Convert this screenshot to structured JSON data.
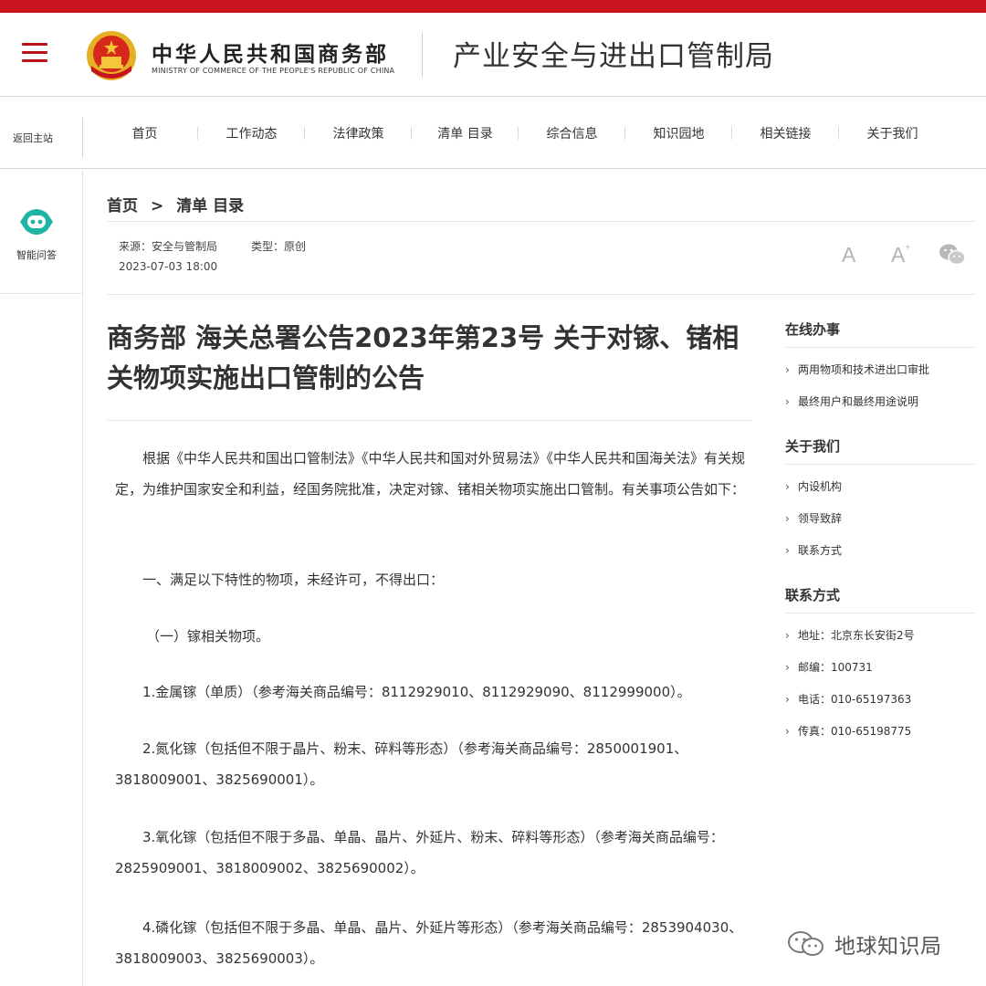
{
  "header": {
    "ministry_cn": "中华人民共和国商务部",
    "ministry_en": "MINISTRY OF COMMERCE OF THE PEOPLE'S REPUBLIC OF CHINA",
    "bureau": "产业安全与进出口管制局"
  },
  "nav": {
    "return_home": "返回主站",
    "items": [
      "首页",
      "工作动态",
      "法律政策",
      "清单 目录",
      "综合信息",
      "知识园地",
      "相关链接",
      "关于我们"
    ]
  },
  "side": {
    "ai_label": "智能问答"
  },
  "breadcrumb": {
    "home": "首页",
    "sep": ">",
    "current": "清单 目录"
  },
  "meta": {
    "source": "来源：安全与管制局",
    "type": "类型：原创",
    "date": "2023-07-03 18:00",
    "font_small": "A",
    "font_large": "A",
    "font_large_sup": "+"
  },
  "article": {
    "title": "商务部 海关总署公告2023年第23号 关于对镓、锗相关物项实施出口管制的公告",
    "paragraphs": [
      "根据《中华人民共和国出口管制法》《中华人民共和国对外贸易法》《中华人民共和国海关法》有关规定，为维护国家安全和利益，经国务院批准，决定对镓、锗相关物项实施出口管制。有关事项公告如下：",
      "一、满足以下特性的物项，未经许可，不得出口：",
      "（一）镓相关物项。",
      "1.金属镓（单质）（参考海关商品编号：8112929010、8112929090、8112999000）。",
      "2.氮化镓（包括但不限于晶片、粉末、碎料等形态）（参考海关商品编号：2850001901、3818009001、3825690001）。",
      "3.氧化镓（包括但不限于多晶、单晶、晶片、外延片、粉末、碎料等形态）（参考海关商品编号：2825909001、3818009002、3825690002）。",
      "4.磷化镓（包括但不限于多晶、单晶、晶片、外延片等形态）（参考海关商品编号：2853904030、3818009003、3825690003）。"
    ]
  },
  "sidebar": {
    "sections": [
      {
        "title": "在线办事",
        "links": [
          "两用物项和技术进出口审批",
          "最终用户和最终用途说明"
        ]
      },
      {
        "title": "关于我们",
        "links": [
          "内设机构",
          "领导致辞",
          "联系方式"
        ]
      },
      {
        "title": "联系方式",
        "links": [
          "地址：北京东长安街2号",
          "邮编：100731",
          "电话：010-65197363",
          "传真：010-65198775"
        ]
      }
    ]
  },
  "watermark": {
    "text": "地球知识局"
  },
  "colors": {
    "brand_red": "#c8141e",
    "menu_red": "#b8121b",
    "ai_teal": "#1fb5a5"
  }
}
